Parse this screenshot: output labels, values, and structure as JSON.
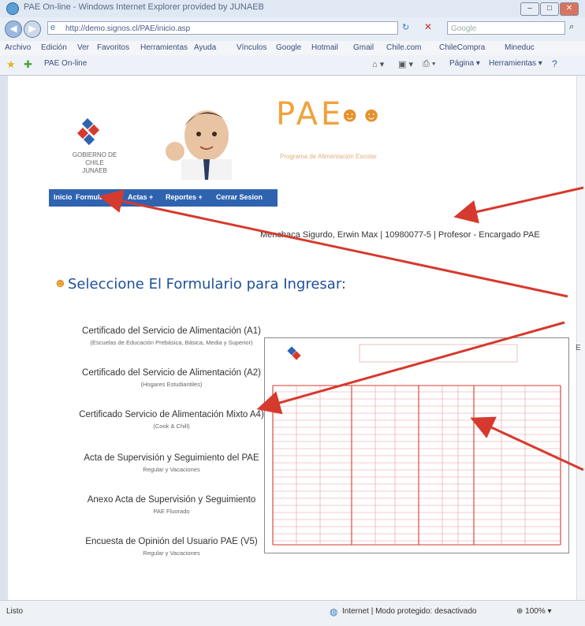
{
  "window": {
    "title": "PAE On-line - Windows Internet Explorer provided by JUNAEB",
    "controls": [
      "–",
      "□",
      "✕"
    ]
  },
  "addressbar": {
    "url": "http://demo.signos.cl/PAE/inicio.asp",
    "search_placeholder": "Google"
  },
  "menubar": {
    "items": [
      "Archivo",
      "Edición",
      "Ver",
      "Favoritos",
      "Herramientas",
      "Ayuda"
    ],
    "links": [
      "Vínculos",
      "Google",
      "Hotmail",
      "Gmail",
      "Chile.com",
      "ChileCompra",
      "Mineduc"
    ]
  },
  "favbar": {
    "tab_label": "PAE On-line",
    "tools": [
      "Página ▾",
      "Herramientas ▾"
    ]
  },
  "page": {
    "gov_text": [
      "GOBIERNO DE CHILE",
      "JUNAEB"
    ],
    "brand": "PAE",
    "brand_subtitle": "Programa de Alimentación Escolar",
    "nav": [
      "Inicio",
      "Formularios +",
      "Actas +",
      "Reportes +",
      "Cerrar Sesion"
    ],
    "user_name": "Menchaca Sigurdo, Erwin Max",
    "user_rut": "10980077-5",
    "user_role": "Profesor - Encargado PAE",
    "section_title": "Seleccione El Formulario para Ingresar:",
    "forms": [
      {
        "title": "Certificado del Servicio de Alimentación (A1)",
        "sub": "(Escuelas de Educación Prebásica, Básica, Media y Superior)"
      },
      {
        "title": "Certificado del Servicio de Alimentación (A2)",
        "sub": "(Hogares Estudiantiles)"
      },
      {
        "title": "Certificado Servicio de Alimentación Mixto A4)",
        "sub": "(Cook & Chill)"
      },
      {
        "title": "Acta de Supervisión y Seguimiento del PAE",
        "sub": "Regular y Vacaciones"
      },
      {
        "title": "Anexo Acta de Supervisión y Seguimiento",
        "sub": "PAE Fluorado"
      },
      {
        "title": "Encuesta de Opinión del Usuario PAE (V5)",
        "sub": "Regular y Vacaciones"
      }
    ],
    "right_edge_letter": "E"
  },
  "statusbar": {
    "left": "Listo",
    "zone": "Internet | Modo protegido: desactivado",
    "zoom": "100%"
  },
  "colors": {
    "nav_bg": "#2f63b0",
    "brand": "#f1a23b",
    "title_blue": "#1f4f99",
    "arrow_red": "#d63a2e"
  }
}
